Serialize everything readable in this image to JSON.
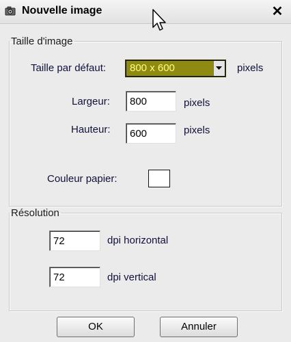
{
  "window": {
    "title": "Nouvelle image",
    "title_icon": "camera-icon",
    "close_symbol": "✕"
  },
  "image_size_group": {
    "legend": "Taille d'image",
    "default_size_label": "Taille par défaut:",
    "default_size_value": "800 x 600",
    "default_size_unit": "pixels",
    "width_label": "Largeur:",
    "width_value": "800",
    "width_unit": "pixels",
    "height_label": "Hauteur:",
    "height_value": "600",
    "height_unit": "pixels",
    "paper_color_label": "Couleur papier:",
    "paper_color": "#ffffff"
  },
  "resolution_group": {
    "legend": "Résolution",
    "horizontal_value": "72",
    "horizontal_unit": "dpi horizontal",
    "vertical_value": "72",
    "vertical_unit": "dpi vertical"
  },
  "buttons": {
    "ok_label": "OK",
    "cancel_label": "Annuler"
  },
  "colors": {
    "select_highlight": "#8e8a12",
    "select_text": "#ffff80"
  }
}
